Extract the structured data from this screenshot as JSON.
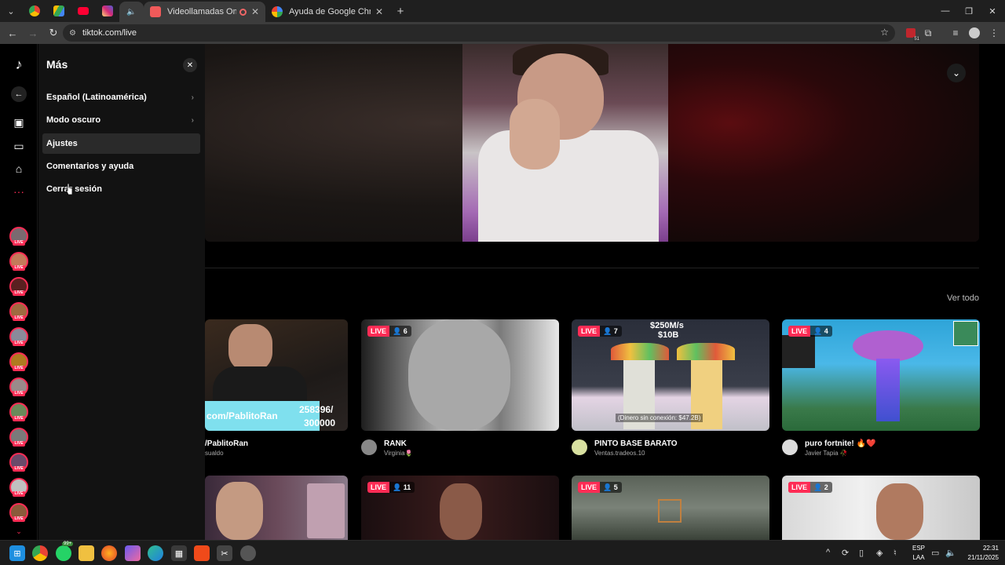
{
  "browser": {
    "tabs": [
      {
        "title": "Videollamadas OmeTV — ",
        "active": true
      },
      {
        "title": "Ayuda de Google Chrome",
        "active": false
      }
    ],
    "new_tab": "+",
    "url": "tiktok.com/live",
    "extension_badge": "51"
  },
  "sidebar": {
    "more_title": "Más",
    "close": "✕",
    "menu": [
      {
        "label": "Español (Latinoamérica)",
        "chevron": true
      },
      {
        "label": "Modo oscuro",
        "chevron": true
      },
      {
        "label": "Ajustes",
        "chevron": false,
        "hover": true
      },
      {
        "label": "Comentarios y ayuda",
        "chevron": false
      },
      {
        "label": "Cerrar sesión",
        "chevron": false
      }
    ],
    "live_badge": "LIVE"
  },
  "main": {
    "see_all": "Ver todo",
    "cards_row1": [
      {
        "live": "",
        "viewers": "",
        "overlay_text": "com/PablitoRan",
        "overlay_count": "258396/",
        "overlay_count2": "300000",
        "title": "/PablitoRan",
        "sub": "sualdo"
      },
      {
        "live": "LIVE",
        "viewers": "6",
        "title": "RANK",
        "sub": "Virginia🌷"
      },
      {
        "live": "LIVE",
        "viewers": "7",
        "overlay_top": "$250M/s",
        "overlay_top2": "$10B",
        "overlay_bottom": "(Dinero sin conexión: $47.2B)",
        "title": "PINTO BASE BARATO",
        "sub": "Ventas.tradeos.10"
      },
      {
        "live": "LIVE",
        "viewers": "4",
        "title": "puro fortnite! 🔥❤️",
        "sub": "Javier Tapia 🥀"
      }
    ],
    "cards_row2": [
      {
        "live": "",
        "viewers": ""
      },
      {
        "live": "LIVE",
        "viewers": "11"
      },
      {
        "live": "LIVE",
        "viewers": "5"
      },
      {
        "live": "LIVE",
        "viewers": "2"
      }
    ]
  },
  "taskbar": {
    "whatsapp_badge": "99+",
    "lang_line1": "ESP",
    "lang_line2": "LAA",
    "time": "22:31",
    "date": "21/11/2025"
  }
}
